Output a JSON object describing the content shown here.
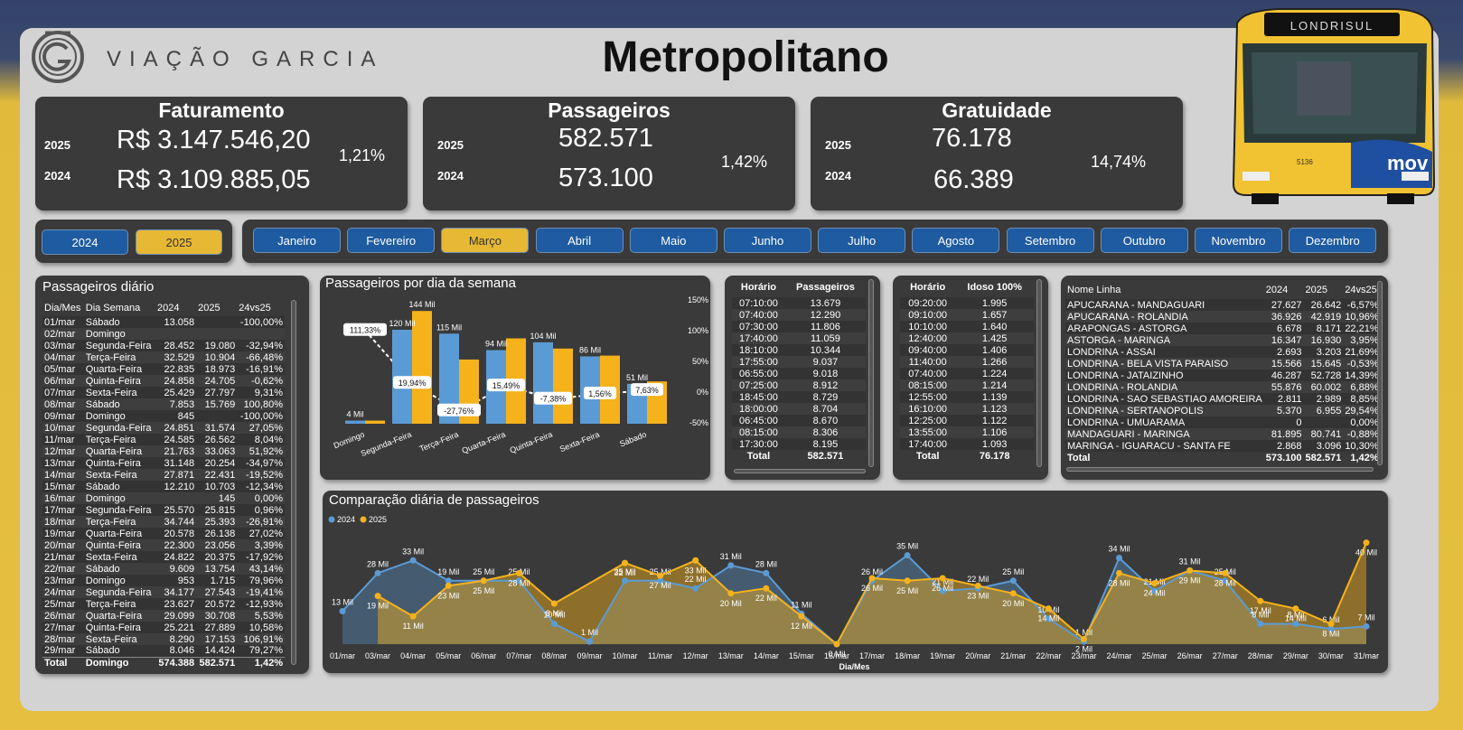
{
  "header": {
    "brand": "VIAÇÃO GARCIA",
    "title": "Metropolitano",
    "bus_sign": "LONDRISUL",
    "bus_brand": "mov",
    "bus_number": "5136"
  },
  "colors": {
    "y2024": "#5b9bd5",
    "y2025": "#f5b21b",
    "button": "#1e5ba0",
    "active": "#e6b833"
  },
  "kpis": [
    {
      "title": "Faturamento",
      "y1": "2025",
      "v1": "R$ 3.147.546,20",
      "y2": "2024",
      "v2": "R$ 3.109.885,05",
      "pct": "1,21%"
    },
    {
      "title": "Passageiros",
      "y1": "2025",
      "v1": "582.571",
      "y2": "2024",
      "v2": "573.100",
      "pct": "1,42%"
    },
    {
      "title": "Gratuidade",
      "y1": "2025",
      "v1": "76.178",
      "y2": "2024",
      "v2": "66.389",
      "pct": "14,74%"
    }
  ],
  "years": [
    {
      "label": "2024",
      "active": false
    },
    {
      "label": "2025",
      "active": true
    }
  ],
  "months": [
    "Janeiro",
    "Fevereiro",
    "Março",
    "Abril",
    "Maio",
    "Junho",
    "Julho",
    "Agosto",
    "Setembro",
    "Outubro",
    "Novembro",
    "Dezembro"
  ],
  "active_month": "Março",
  "daily": {
    "title": "Passageiros diário",
    "headers": [
      "Dia/Mes",
      "Dia Semana",
      "2024",
      "2025",
      "24vs25"
    ],
    "rows": [
      [
        "01/mar",
        "Sábado",
        "13.058",
        "",
        "-100,00%"
      ],
      [
        "02/mar",
        "Domingo",
        "",
        "",
        ""
      ],
      [
        "03/mar",
        "Segunda-Feira",
        "28.452",
        "19.080",
        "-32,94%"
      ],
      [
        "04/mar",
        "Terça-Feira",
        "32.529",
        "10.904",
        "-66,48%"
      ],
      [
        "05/mar",
        "Quarta-Feira",
        "22.835",
        "18.973",
        "-16,91%"
      ],
      [
        "06/mar",
        "Quinta-Feira",
        "24.858",
        "24.705",
        "-0,62%"
      ],
      [
        "07/mar",
        "Sexta-Feira",
        "25.429",
        "27.797",
        "9,31%"
      ],
      [
        "08/mar",
        "Sábado",
        "7.853",
        "15.769",
        "100,80%"
      ],
      [
        "09/mar",
        "Domingo",
        "845",
        "",
        "-100,00%"
      ],
      [
        "10/mar",
        "Segunda-Feira",
        "24.851",
        "31.574",
        "27,05%"
      ],
      [
        "11/mar",
        "Terça-Feira",
        "24.585",
        "26.562",
        "8,04%"
      ],
      [
        "12/mar",
        "Quarta-Feira",
        "21.763",
        "33.063",
        "51,92%"
      ],
      [
        "13/mar",
        "Quinta-Feira",
        "31.148",
        "20.254",
        "-34,97%"
      ],
      [
        "14/mar",
        "Sexta-Feira",
        "27.871",
        "22.431",
        "-19,52%"
      ],
      [
        "15/mar",
        "Sábado",
        "12.210",
        "10.703",
        "-12,34%"
      ],
      [
        "16/mar",
        "Domingo",
        "",
        "145",
        "0,00%"
      ],
      [
        "17/mar",
        "Segunda-Feira",
        "25.570",
        "25.815",
        "0,96%"
      ],
      [
        "18/mar",
        "Terça-Feira",
        "34.744",
        "25.393",
        "-26,91%"
      ],
      [
        "19/mar",
        "Quarta-Feira",
        "20.578",
        "26.138",
        "27,02%"
      ],
      [
        "20/mar",
        "Quinta-Feira",
        "22.300",
        "23.056",
        "3,39%"
      ],
      [
        "21/mar",
        "Sexta-Feira",
        "24.822",
        "20.375",
        "-17,92%"
      ],
      [
        "22/mar",
        "Sábado",
        "9.609",
        "13.754",
        "43,14%"
      ],
      [
        "23/mar",
        "Domingo",
        "953",
        "1.715",
        "79,96%"
      ],
      [
        "24/mar",
        "Segunda-Feira",
        "34.177",
        "27.543",
        "-19,41%"
      ],
      [
        "25/mar",
        "Terça-Feira",
        "23.627",
        "20.572",
        "-12,93%"
      ],
      [
        "26/mar",
        "Quarta-Feira",
        "29.099",
        "30.708",
        "5,53%"
      ],
      [
        "27/mar",
        "Quinta-Feira",
        "25.221",
        "27.889",
        "10,58%"
      ],
      [
        "28/mar",
        "Sexta-Feira",
        "8.290",
        "17.153",
        "106,91%"
      ],
      [
        "29/mar",
        "Sábado",
        "8.046",
        "14.424",
        "79,27%"
      ]
    ],
    "total": [
      "Total",
      "Domingo",
      "574.388",
      "582.571",
      "1,42%"
    ]
  },
  "weekday_chart": {
    "title": "Passageiros por dia da semana",
    "pct_axis": [
      "150%",
      "100%",
      "50%",
      "0%",
      "-50%"
    ]
  },
  "horario": {
    "headers": [
      "Horário",
      "Passageiros"
    ],
    "rows": [
      [
        "07:10:00",
        "13.679"
      ],
      [
        "07:40:00",
        "12.290"
      ],
      [
        "07:30:00",
        "11.806"
      ],
      [
        "17:40:00",
        "11.059"
      ],
      [
        "18:10:00",
        "10.344"
      ],
      [
        "17:55:00",
        "9.037"
      ],
      [
        "06:55:00",
        "9.018"
      ],
      [
        "07:25:00",
        "8.912"
      ],
      [
        "18:45:00",
        "8.729"
      ],
      [
        "18:00:00",
        "8.704"
      ],
      [
        "06:45:00",
        "8.670"
      ],
      [
        "08:15:00",
        "8.306"
      ],
      [
        "17:30:00",
        "8.195"
      ]
    ],
    "total": [
      "Total",
      "582.571"
    ]
  },
  "idoso": {
    "headers": [
      "Horário",
      "Idoso 100%"
    ],
    "rows": [
      [
        "09:20:00",
        "1.995"
      ],
      [
        "09:10:00",
        "1.657"
      ],
      [
        "10:10:00",
        "1.640"
      ],
      [
        "12:40:00",
        "1.425"
      ],
      [
        "09:40:00",
        "1.406"
      ],
      [
        "11:40:00",
        "1.266"
      ],
      [
        "07:40:00",
        "1.224"
      ],
      [
        "08:15:00",
        "1.214"
      ],
      [
        "12:55:00",
        "1.139"
      ],
      [
        "16:10:00",
        "1.123"
      ],
      [
        "12:25:00",
        "1.122"
      ],
      [
        "13:55:00",
        "1.106"
      ],
      [
        "17:40:00",
        "1.093"
      ]
    ],
    "total": [
      "Total",
      "76.178"
    ]
  },
  "lines": {
    "headers": [
      "Nome Linha",
      "2024",
      "2025",
      "24vs25"
    ],
    "rows": [
      [
        "APUCARANA - MANDAGUARI",
        "27.627",
        "26.642",
        "-6,57%"
      ],
      [
        "APUCARANA - ROLANDIA",
        "36.926",
        "42.919",
        "10,96%"
      ],
      [
        "ARAPONGAS - ASTORGA",
        "6.678",
        "8.171",
        "22,21%"
      ],
      [
        "ASTORGA - MARINGA",
        "16.347",
        "16.930",
        "3,95%"
      ],
      [
        "LONDRINA - ASSAI",
        "2.693",
        "3.203",
        "21,69%"
      ],
      [
        "LONDRINA - BELA VISTA PARAISO",
        "15.566",
        "15.645",
        "-0,53%"
      ],
      [
        "LONDRINA - JATAIZINHO",
        "46.287",
        "52.728",
        "14,39%"
      ],
      [
        "LONDRINA - ROLANDIA",
        "55.876",
        "60.002",
        "6,88%"
      ],
      [
        "LONDRINA - SAO SEBASTIAO AMOREIRA",
        "2.811",
        "2.989",
        "8,85%"
      ],
      [
        "LONDRINA - SERTANOPOLIS",
        "5.370",
        "6.955",
        "29,54%"
      ],
      [
        "LONDRINA - UMUARAMA",
        "0",
        "",
        "0,00%"
      ],
      [
        "MANDAGUARI - MARINGA",
        "81.895",
        "80.741",
        "-0,88%"
      ],
      [
        "MARINGA - IGUARACU - SANTA FE",
        "2.868",
        "3.096",
        "10,30%"
      ]
    ],
    "total": [
      "Total",
      "573.100",
      "582.571",
      "1,42%"
    ]
  },
  "compare": {
    "title": "Comparação diária de passageiros",
    "legend": [
      "2024",
      "2025"
    ],
    "xlabel": "Dia/Mes"
  },
  "chart_data": [
    {
      "type": "bar",
      "title": "Passageiros por dia da semana",
      "categories": [
        "Domingo",
        "Segunda-Feira",
        "Terça-Feira",
        "Quarta-Feira",
        "Quinta-Feira",
        "Sexta-Feira",
        "Sábado"
      ],
      "series": [
        {
          "name": "2024",
          "values": [
            4,
            120,
            115,
            94,
            104,
            86,
            51
          ]
        },
        {
          "name": "2025",
          "values": [
            4,
            144,
            82,
            109,
            96,
            87,
            54
          ]
        }
      ],
      "data_labels": [
        "4 Mil",
        "120 Mil",
        "115 Mil",
        "94 Mil",
        "104 Mil",
        "86 Mil",
        "51 Mil"
      ],
      "label_2025": "144 Mil",
      "variation": [
        111.33,
        19.94,
        -27.76,
        15.49,
        -7.38,
        1.56,
        7.63
      ],
      "variation_labels": [
        "111,33%",
        "19,94%",
        "-27,76%",
        "15,49%",
        "-7,38%",
        "1,56%",
        "7,63%"
      ],
      "ylim": [
        0,
        150
      ],
      "pct_ylim": [
        -50,
        150
      ]
    },
    {
      "type": "area",
      "title": "Comparação diária de passageiros",
      "xlabel": "Dia/Mes",
      "x": [
        "01/mar",
        "03/mar",
        "04/mar",
        "05/mar",
        "06/mar",
        "07/mar",
        "08/mar",
        "09/mar",
        "10/mar",
        "11/mar",
        "12/mar",
        "13/mar",
        "14/mar",
        "15/mar",
        "16/mar",
        "17/mar",
        "18/mar",
        "19/mar",
        "20/mar",
        "21/mar",
        "22/mar",
        "23/mar",
        "24/mar",
        "25/mar",
        "26/mar",
        "27/mar",
        "28/mar",
        "29/mar",
        "30/mar",
        "31/mar"
      ],
      "series": [
        {
          "name": "2024",
          "values": [
            13,
            28,
            33,
            25,
            25,
            25,
            8,
            1,
            25,
            25,
            22,
            31,
            28,
            12,
            0,
            25,
            35,
            21,
            22,
            25,
            10,
            1,
            34,
            21,
            29,
            25,
            8,
            8,
            6,
            7
          ],
          "labels": [
            "13 Mil",
            "28 Mil",
            "33 Mil",
            "19 Mil",
            "25 Mil",
            "25 Mil",
            "10 Mil",
            "1 Mil",
            "25 Mil",
            "25 Mil",
            "22 Mil",
            "31 Mil",
            "28 Mil",
            "11 Mil",
            "",
            "26 Mil",
            "35 Mil",
            "21 Mil",
            "22 Mil",
            "25 Mil",
            "10 Mil",
            "1 Mil",
            "34 Mil",
            "21 Mil",
            "31 Mil",
            "25 Mil",
            "8 Mil",
            "8 Mil",
            "6 Mil",
            "7 Mil"
          ]
        },
        {
          "name": "2025",
          "values": [
            null,
            19,
            11,
            23,
            25,
            28,
            16,
            null,
            32,
            27,
            33,
            20,
            22,
            11,
            0,
            26,
            25,
            26,
            23,
            20,
            14,
            2,
            28,
            24,
            29,
            28,
            17,
            14,
            8,
            40
          ],
          "labels": [
            "",
            "19 Mil",
            "11 Mil",
            "23 Mil",
            "25 Mil",
            "28 Mil",
            "8 Mil",
            "",
            "32 Mil",
            "27 Mil",
            "33 Mil",
            "20 Mil",
            "22 Mil",
            "12 Mil",
            "0 Mil",
            "26 Mil",
            "25 Mil",
            "26 Mil",
            "23 Mil",
            "20 Mil",
            "14 Mil",
            "2 Mil",
            "28 Mil",
            "24 Mil",
            "29 Mil",
            "28 Mil",
            "17 Mil",
            "14 Mil",
            "8 Mil",
            "40 Mil"
          ]
        }
      ],
      "ylim": [
        0,
        42
      ]
    }
  ]
}
